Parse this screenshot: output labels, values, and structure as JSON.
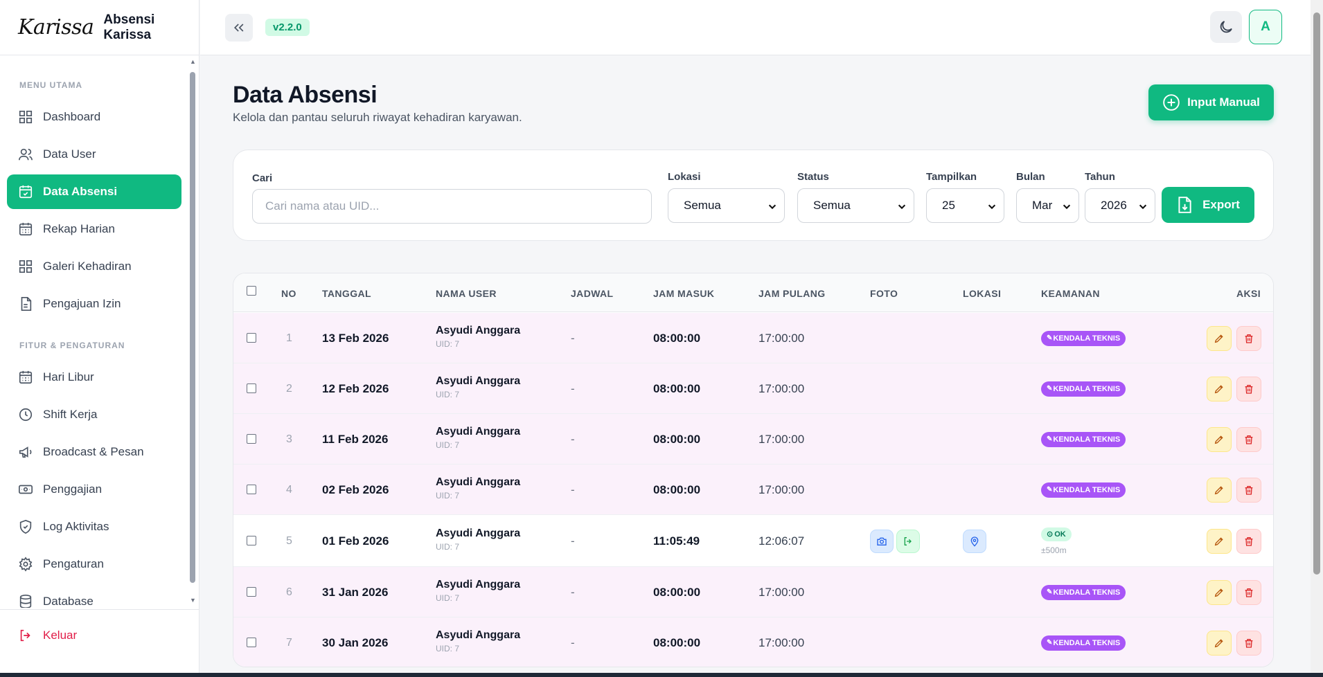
{
  "brand": {
    "logo": "Karissa",
    "title": "Absensi Karissa"
  },
  "topbar": {
    "version": "v2.2.0",
    "avatar_initial": "A"
  },
  "sidebar": {
    "section_main": "MENU UTAMA",
    "section_features": "FITUR & PENGATURAN",
    "main_items": [
      {
        "label": "Dashboard",
        "icon": "dashboard-icon"
      },
      {
        "label": "Data User",
        "icon": "users-icon"
      },
      {
        "label": "Data Absensi",
        "icon": "calendar-check-icon",
        "active": true
      },
      {
        "label": "Rekap Harian",
        "icon": "calendar-grid-icon"
      },
      {
        "label": "Galeri Kehadiran",
        "icon": "gallery-icon"
      },
      {
        "label": "Pengajuan Izin",
        "icon": "document-icon"
      }
    ],
    "feature_items": [
      {
        "label": "Hari Libur",
        "icon": "calendar-grid-icon"
      },
      {
        "label": "Shift Kerja",
        "icon": "clock-icon"
      },
      {
        "label": "Broadcast & Pesan",
        "icon": "megaphone-icon"
      },
      {
        "label": "Penggajian",
        "icon": "money-icon"
      },
      {
        "label": "Log Aktivitas",
        "icon": "shield-icon"
      },
      {
        "label": "Pengaturan",
        "icon": "gear-icon"
      },
      {
        "label": "Database",
        "icon": "database-icon"
      }
    ],
    "logout": "Keluar"
  },
  "page": {
    "title": "Data Absensi",
    "subtitle": "Kelola dan pantau seluruh riwayat kehadiran karyawan.",
    "input_manual": "Input Manual"
  },
  "filters": {
    "search_label": "Cari",
    "search_placeholder": "Cari nama atau UID...",
    "lokasi_label": "Lokasi",
    "lokasi_value": "Semua",
    "status_label": "Status",
    "status_value": "Semua",
    "tampilkan_label": "Tampilkan",
    "tampilkan_value": "25",
    "bulan_label": "Bulan",
    "bulan_value": "Mar",
    "tahun_label": "Tahun",
    "tahun_value": "2026",
    "export": "Export"
  },
  "table": {
    "headers": {
      "no": "NO",
      "tanggal": "TANGGAL",
      "nama": "NAMA USER",
      "jadwal": "JADWAL",
      "masuk": "JAM MASUK",
      "pulang": "JAM PULANG",
      "foto": "FOTO",
      "lokasi": "LOKASI",
      "keamanan": "KEAMANAN",
      "aksi": "AKSI"
    },
    "rows": [
      {
        "no": "1",
        "tanggal": "13 Feb 2026",
        "nama": "Asyudi Anggara",
        "uid": "UID: 7",
        "jadwal": "-",
        "masuk": "08:00:00",
        "pulang": "17:00:00",
        "keamanan": "KENDALA TEKNIS"
      },
      {
        "no": "2",
        "tanggal": "12 Feb 2026",
        "nama": "Asyudi Anggara",
        "uid": "UID: 7",
        "jadwal": "-",
        "masuk": "08:00:00",
        "pulang": "17:00:00",
        "keamanan": "KENDALA TEKNIS"
      },
      {
        "no": "3",
        "tanggal": "11 Feb 2026",
        "nama": "Asyudi Anggara",
        "uid": "UID: 7",
        "jadwal": "-",
        "masuk": "08:00:00",
        "pulang": "17:00:00",
        "keamanan": "KENDALA TEKNIS"
      },
      {
        "no": "4",
        "tanggal": "02 Feb 2026",
        "nama": "Asyudi Anggara",
        "uid": "UID: 7",
        "jadwal": "-",
        "masuk": "08:00:00",
        "pulang": "17:00:00",
        "keamanan": "KENDALA TEKNIS"
      },
      {
        "no": "5",
        "tanggal": "01 Feb 2026",
        "nama": "Asyudi Anggara",
        "uid": "UID: 7",
        "jadwal": "-",
        "masuk": "11:05:49",
        "pulang": "12:06:07",
        "keamanan": "OK",
        "radius": "±500m"
      },
      {
        "no": "6",
        "tanggal": "31 Jan 2026",
        "nama": "Asyudi Anggara",
        "uid": "UID: 7",
        "jadwal": "-",
        "masuk": "08:00:00",
        "pulang": "17:00:00",
        "keamanan": "KENDALA TEKNIS"
      },
      {
        "no": "7",
        "tanggal": "30 Jan 2026",
        "nama": "Asyudi Anggara",
        "uid": "UID: 7",
        "jadwal": "-",
        "masuk": "08:00:00",
        "pulang": "17:00:00",
        "keamanan": "KENDALA TEKNIS"
      }
    ]
  },
  "colors": {
    "accent": "#10b981",
    "badge_kendala": "#a855f7",
    "row_highlight": "#fbf1fb"
  }
}
